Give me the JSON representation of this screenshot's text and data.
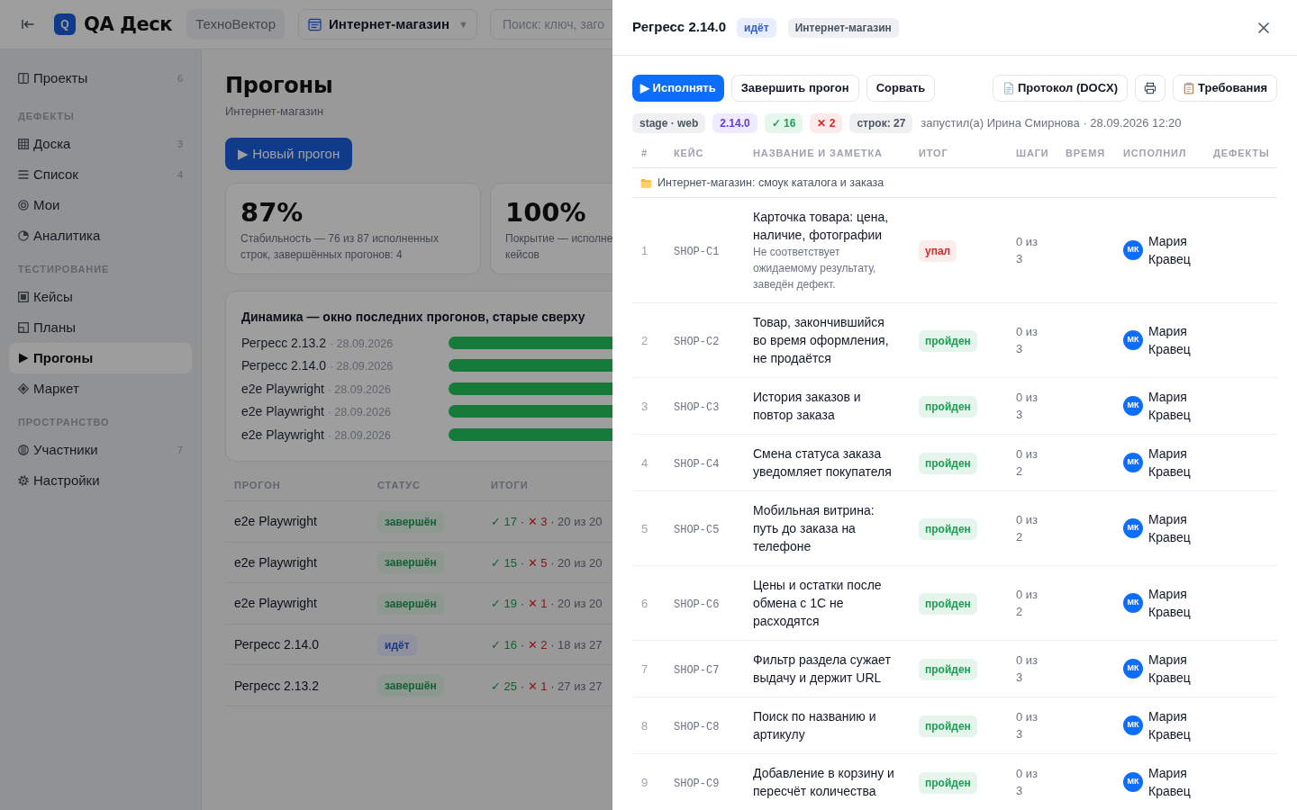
{
  "header": {
    "logo_letter": "Q",
    "app_name": "QA Деск",
    "workspace": "ТехноВектор",
    "project": "Интернет-магазин",
    "project_caret": "▼",
    "search": {
      "placeholder": "Поиск: ключ, заго"
    }
  },
  "sidebar": {
    "sections": [
      {
        "items": [
          {
            "label": "Проекты",
            "count": "6",
            "selected": false
          }
        ]
      },
      {
        "heading": "ДЕФЕКТЫ",
        "items": [
          {
            "label": "Доска",
            "count": "3",
            "selected": false
          },
          {
            "label": "Список",
            "count": "4",
            "selected": false
          },
          {
            "label": "Мои",
            "selected": false
          },
          {
            "label": "Аналитика",
            "selected": false
          }
        ]
      },
      {
        "heading": "ТЕСТИРОВАНИЕ",
        "items": [
          {
            "label": "Кейсы",
            "selected": false
          },
          {
            "label": "Планы",
            "selected": false
          },
          {
            "label": "Прогоны",
            "selected": true
          },
          {
            "label": "Маркет",
            "selected": false
          }
        ]
      },
      {
        "heading": "ПРОСТРАНСТВО",
        "items": [
          {
            "label": "Участники",
            "count": "7",
            "selected": false
          },
          {
            "label": "Настройки",
            "selected": false
          }
        ]
      }
    ]
  },
  "page": {
    "title": "Прогоны",
    "subtitle": "Интернет-магазин",
    "new_run_button": "▶ Новый прогон",
    "stats": [
      {
        "value": "87%",
        "description": [
          "Стабильность — 76 из 87 исполненных",
          "строк, завершённых прогонов: 4"
        ]
      },
      {
        "value": "100%",
        "description": [
          "Покрытие — исполне",
          "кейсов"
        ]
      }
    ],
    "trend": {
      "title": "Динамика — окно последних прогонов, старые сверху",
      "rows": [
        {
          "label": "Регресс 2.13.2",
          "date": "· 28.09.2026"
        },
        {
          "label": "Регресс 2.14.0",
          "date": "· 28.09.2026"
        },
        {
          "label": "e2e Playwright",
          "date": "· 28.09.2026"
        },
        {
          "label": "e2e Playwright",
          "date": "· 28.09.2026"
        },
        {
          "label": "e2e Playwright",
          "date": "· 28.09.2026"
        }
      ]
    },
    "runs": {
      "columns": [
        "ПРОГОН",
        "СТАТУС",
        "ИТОГИ"
      ],
      "rows": [
        {
          "name": "e2e Playwright",
          "status": {
            "kind": "done",
            "label": "завершён"
          },
          "totals": [
            {
              "kind": "pass",
              "text": "✓ 17"
            },
            {
              "kind": "sep",
              "text": "·"
            },
            {
              "kind": "fail",
              "text": "✕ 3"
            },
            {
              "kind": "sep",
              "text": "·"
            },
            {
              "kind": "total",
              "text": "20 из 20"
            }
          ]
        },
        {
          "name": "e2e Playwright",
          "status": {
            "kind": "done",
            "label": "завершён"
          },
          "totals": [
            {
              "kind": "pass",
              "text": "✓ 15"
            },
            {
              "kind": "sep",
              "text": "·"
            },
            {
              "kind": "fail",
              "text": "✕ 5"
            },
            {
              "kind": "sep",
              "text": "·"
            },
            {
              "kind": "total",
              "text": "20 из 20"
            }
          ]
        },
        {
          "name": "e2e Playwright",
          "status": {
            "kind": "done",
            "label": "завершён"
          },
          "totals": [
            {
              "kind": "pass",
              "text": "✓ 19"
            },
            {
              "kind": "sep",
              "text": "·"
            },
            {
              "kind": "fail",
              "text": "✕ 1"
            },
            {
              "kind": "sep",
              "text": "·"
            },
            {
              "kind": "total",
              "text": "20 из 20"
            }
          ]
        },
        {
          "name": "Регресс 2.14.0",
          "status": {
            "kind": "running",
            "label": "идёт"
          },
          "totals": [
            {
              "kind": "pass",
              "text": "✓ 16"
            },
            {
              "kind": "sep",
              "text": "·"
            },
            {
              "kind": "fail",
              "text": "✕ 2"
            },
            {
              "kind": "sep",
              "text": "·"
            },
            {
              "kind": "total",
              "text": "18 из 27"
            }
          ]
        },
        {
          "name": "Регресс 2.13.2",
          "status": {
            "kind": "done",
            "label": "завершён"
          },
          "totals": [
            {
              "kind": "pass",
              "text": "✓ 25"
            },
            {
              "kind": "sep",
              "text": "·"
            },
            {
              "kind": "fail",
              "text": "✕ 1"
            },
            {
              "kind": "sep",
              "text": "·"
            },
            {
              "kind": "total",
              "text": "27 из 27"
            }
          ]
        }
      ]
    }
  },
  "drawer": {
    "title": "Регресс 2.14.0",
    "badges": [
      {
        "kind": "running",
        "label": "идёт"
      },
      {
        "kind": "neutral",
        "label": "Интернет-магазин"
      }
    ],
    "actions": [
      {
        "kind": "primary",
        "label": "▶ Исполнять"
      },
      {
        "kind": "secondary",
        "label": "Завершить прогон"
      },
      {
        "kind": "secondary",
        "label": "Сорвать"
      },
      {
        "kind": "document",
        "label": "Протокол (DOCX)"
      },
      {
        "kind": "print"
      },
      {
        "kind": "clipboard",
        "label": "Требования"
      }
    ],
    "chips": [
      {
        "kind": "neutral",
        "text": "stage · web"
      },
      {
        "kind": "version",
        "text": "2.14.0"
      },
      {
        "kind": "pass",
        "text": "✓ 16"
      },
      {
        "kind": "fail",
        "text": "✕ 2"
      },
      {
        "kind": "neutral",
        "text": "строк: 27"
      }
    ],
    "launched": "запустил(а) Ирина Смирнова · 28.09.2026 12:20",
    "cases": {
      "columns": [
        "#",
        "КЕЙС",
        "НАЗВАНИЕ И ЗАМЕТКА",
        "ИТОГ",
        "ШАГИ",
        "ВРЕМЯ",
        "ИСПОЛНИЛ",
        "ДЕФЕКТЫ"
      ],
      "group": "Интернет-магазин: смоук каталога и заказа",
      "rows": [
        {
          "num": "1",
          "key": "SHOP-C1",
          "title": "Карточка товара: цена, наличие, фотографии",
          "note": "Не соответствует ожидаемому результату, заведён дефект.",
          "result": {
            "kind": "failed",
            "label": "упал"
          },
          "steps": "0 из 3",
          "assignee": {
            "initials": "МК",
            "name": "Мария Кравец"
          }
        },
        {
          "num": "2",
          "key": "SHOP-C2",
          "title": "Товар, закончившийся во время оформления, не продаётся",
          "result": {
            "kind": "passed",
            "label": "пройден"
          },
          "steps": "0 из 3",
          "assignee": {
            "initials": "МК",
            "name": "Мария Кравец"
          }
        },
        {
          "num": "3",
          "key": "SHOP-C3",
          "title": "История заказов и повтор заказа",
          "result": {
            "kind": "passed",
            "label": "пройден"
          },
          "steps": "0 из 3",
          "assignee": {
            "initials": "МК",
            "name": "Мария Кравец"
          }
        },
        {
          "num": "4",
          "key": "SHOP-C4",
          "title": "Смена статуса заказа уведомляет покупателя",
          "result": {
            "kind": "passed",
            "label": "пройден"
          },
          "steps": "0 из 2",
          "assignee": {
            "initials": "МК",
            "name": "Мария Кравец"
          }
        },
        {
          "num": "5",
          "key": "SHOP-C5",
          "title": "Мобильная витрина: путь до заказа на телефоне",
          "result": {
            "kind": "passed",
            "label": "пройден"
          },
          "steps": "0 из 2",
          "assignee": {
            "initials": "МК",
            "name": "Мария Кравец"
          }
        },
        {
          "num": "6",
          "key": "SHOP-C6",
          "title": "Цены и остатки после обмена с 1С не расходятся",
          "result": {
            "kind": "passed",
            "label": "пройден"
          },
          "steps": "0 из 2",
          "assignee": {
            "initials": "МК",
            "name": "Мария Кравец"
          }
        },
        {
          "num": "7",
          "key": "SHOP-C7",
          "title": "Фильтр раздела сужает выдачу и держит URL",
          "result": {
            "kind": "passed",
            "label": "пройден"
          },
          "steps": "0 из 3",
          "assignee": {
            "initials": "МК",
            "name": "Мария Кравец"
          }
        },
        {
          "num": "8",
          "key": "SHOP-C8",
          "title": "Поиск по названию и артикулу",
          "result": {
            "kind": "passed",
            "label": "пройден"
          },
          "steps": "0 из 3",
          "assignee": {
            "initials": "МК",
            "name": "Мария Кравец"
          }
        },
        {
          "num": "9",
          "key": "SHOP-C9",
          "title": "Добавление в корзину и пересчёт количества",
          "result": {
            "kind": "passed",
            "label": "пройден"
          },
          "steps": "0 из 3",
          "assignee": {
            "initials": "МК",
            "name": "Мария Кравец"
          }
        }
      ]
    }
  }
}
